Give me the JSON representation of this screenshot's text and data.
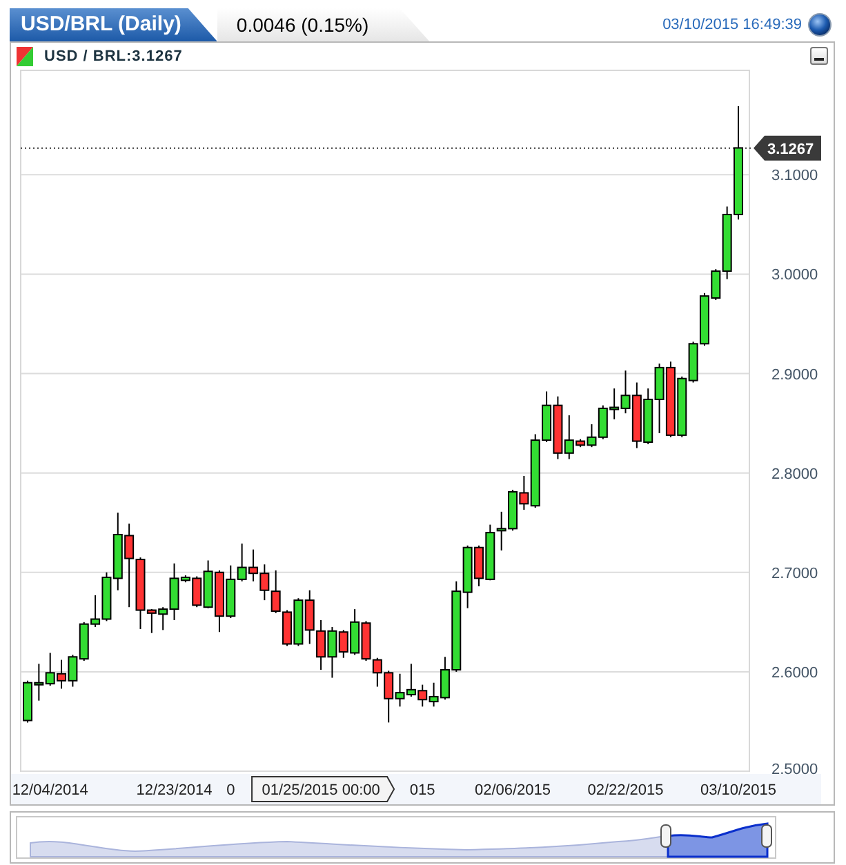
{
  "header": {
    "title": "USD/BRL (Daily)",
    "change": "0.0046 (0.15%)",
    "timestamp": "03/10/2015 16:49:39"
  },
  "chart": {
    "legend": "USD / BRL:3.1267",
    "crosshair_label": "01/25/2015 00:00",
    "chart_data": {
      "type": "candlestick",
      "ylim": [
        2.5,
        3.205
      ],
      "grid": true,
      "ref_lines": [
        {
          "axis": "y",
          "value": 3.1267,
          "label": "3.1267"
        }
      ],
      "yticks": [
        {
          "value": 3.1,
          "label": "3.1000"
        },
        {
          "value": 3.0,
          "label": "3.0000"
        },
        {
          "value": 2.9,
          "label": "2.9000"
        },
        {
          "value": 2.8,
          "label": "2.8000"
        },
        {
          "value": 2.7,
          "label": "2.7000"
        },
        {
          "value": 2.6,
          "label": "2.6000"
        },
        {
          "value": 2.5,
          "label": "2.5000"
        }
      ],
      "categories": [
        null,
        null,
        "12/04/2014",
        null,
        null,
        null,
        null,
        null,
        null,
        null,
        null,
        null,
        null,
        "12/23/2014",
        null,
        null,
        null,
        null,
        "0",
        null,
        null,
        null,
        null,
        null,
        null,
        null,
        null,
        null,
        null,
        null,
        null,
        null,
        null,
        null,
        null,
        "015",
        null,
        null,
        null,
        null,
        null,
        null,
        null,
        "02/06/2015",
        null,
        null,
        null,
        null,
        null,
        null,
        null,
        null,
        null,
        "02/22/2015",
        null,
        null,
        null,
        null,
        null,
        null,
        null,
        null,
        null,
        "03/10/2015"
      ],
      "ohlc": [
        [
          2.551,
          2.591,
          2.549,
          2.589
        ],
        [
          2.588,
          2.608,
          2.571,
          2.589
        ],
        [
          2.588,
          2.619,
          2.586,
          2.599
        ],
        [
          2.598,
          2.612,
          2.583,
          2.591
        ],
        [
          2.591,
          2.617,
          2.585,
          2.615
        ],
        [
          2.613,
          2.65,
          2.611,
          2.648
        ],
        [
          2.648,
          2.677,
          2.645,
          2.653
        ],
        [
          2.653,
          2.7,
          2.651,
          2.695
        ],
        [
          2.694,
          2.76,
          2.682,
          2.738
        ],
        [
          2.737,
          2.749,
          2.665,
          2.714
        ],
        [
          2.713,
          2.715,
          2.643,
          2.662
        ],
        [
          2.662,
          2.663,
          2.639,
          2.659
        ],
        [
          2.658,
          2.665,
          2.642,
          2.663
        ],
        [
          2.663,
          2.709,
          2.652,
          2.694
        ],
        [
          2.692,
          2.697,
          2.69,
          2.695
        ],
        [
          2.694,
          2.696,
          2.665,
          2.667
        ],
        [
          2.665,
          2.712,
          2.664,
          2.701
        ],
        [
          2.7,
          2.702,
          2.64,
          2.656
        ],
        [
          2.656,
          2.707,
          2.654,
          2.693
        ],
        [
          2.693,
          2.729,
          2.691,
          2.705
        ],
        [
          2.705,
          2.723,
          2.691,
          2.699
        ],
        [
          2.699,
          2.708,
          2.672,
          2.682
        ],
        [
          2.681,
          2.702,
          2.659,
          2.661
        ],
        [
          2.66,
          2.662,
          2.626,
          2.628
        ],
        [
          2.628,
          2.674,
          2.626,
          2.672
        ],
        [
          2.672,
          2.682,
          2.628,
          2.642
        ],
        [
          2.641,
          2.652,
          2.602,
          2.615
        ],
        [
          2.615,
          2.645,
          2.594,
          2.641
        ],
        [
          2.64,
          2.642,
          2.614,
          2.62
        ],
        [
          2.619,
          2.663,
          2.617,
          2.65
        ],
        [
          2.649,
          2.651,
          2.611,
          2.613
        ],
        [
          2.612,
          2.614,
          2.585,
          2.599
        ],
        [
          2.599,
          2.601,
          2.549,
          2.573
        ],
        [
          2.573,
          2.598,
          2.565,
          2.579
        ],
        [
          2.577,
          2.608,
          2.575,
          2.582
        ],
        [
          2.581,
          2.587,
          2.565,
          2.572
        ],
        [
          2.57,
          2.589,
          2.565,
          2.575
        ],
        [
          2.574,
          2.615,
          2.572,
          2.602
        ],
        [
          2.602,
          2.691,
          2.6,
          2.681
        ],
        [
          2.68,
          2.727,
          2.664,
          2.725
        ],
        [
          2.725,
          2.727,
          2.686,
          2.694
        ],
        [
          2.693,
          2.748,
          2.692,
          2.74
        ],
        [
          2.742,
          2.761,
          2.722,
          2.744
        ],
        [
          2.744,
          2.783,
          2.742,
          2.781
        ],
        [
          2.78,
          2.797,
          2.763,
          2.769
        ],
        [
          2.767,
          2.839,
          2.765,
          2.833
        ],
        [
          2.833,
          2.882,
          2.831,
          2.868
        ],
        [
          2.868,
          2.877,
          2.814,
          2.82
        ],
        [
          2.82,
          2.858,
          2.814,
          2.833
        ],
        [
          2.832,
          2.834,
          2.826,
          2.828
        ],
        [
          2.828,
          2.849,
          2.826,
          2.836
        ],
        [
          2.836,
          2.868,
          2.834,
          2.865
        ],
        [
          2.866,
          2.885,
          2.854,
          2.866
        ],
        [
          2.865,
          2.903,
          2.86,
          2.878
        ],
        [
          2.878,
          2.891,
          2.825,
          2.832
        ],
        [
          2.831,
          2.885,
          2.829,
          2.874
        ],
        [
          2.874,
          2.91,
          2.84,
          2.906
        ],
        [
          2.906,
          2.912,
          2.836,
          2.838
        ],
        [
          2.838,
          2.897,
          2.836,
          2.895
        ],
        [
          2.893,
          2.932,
          2.891,
          2.93
        ],
        [
          2.93,
          2.981,
          2.928,
          2.978
        ],
        [
          2.976,
          3.005,
          2.974,
          3.003
        ],
        [
          3.003,
          3.068,
          2.995,
          3.06
        ],
        [
          3.06,
          3.169,
          3.055,
          3.127
        ]
      ]
    }
  }
}
